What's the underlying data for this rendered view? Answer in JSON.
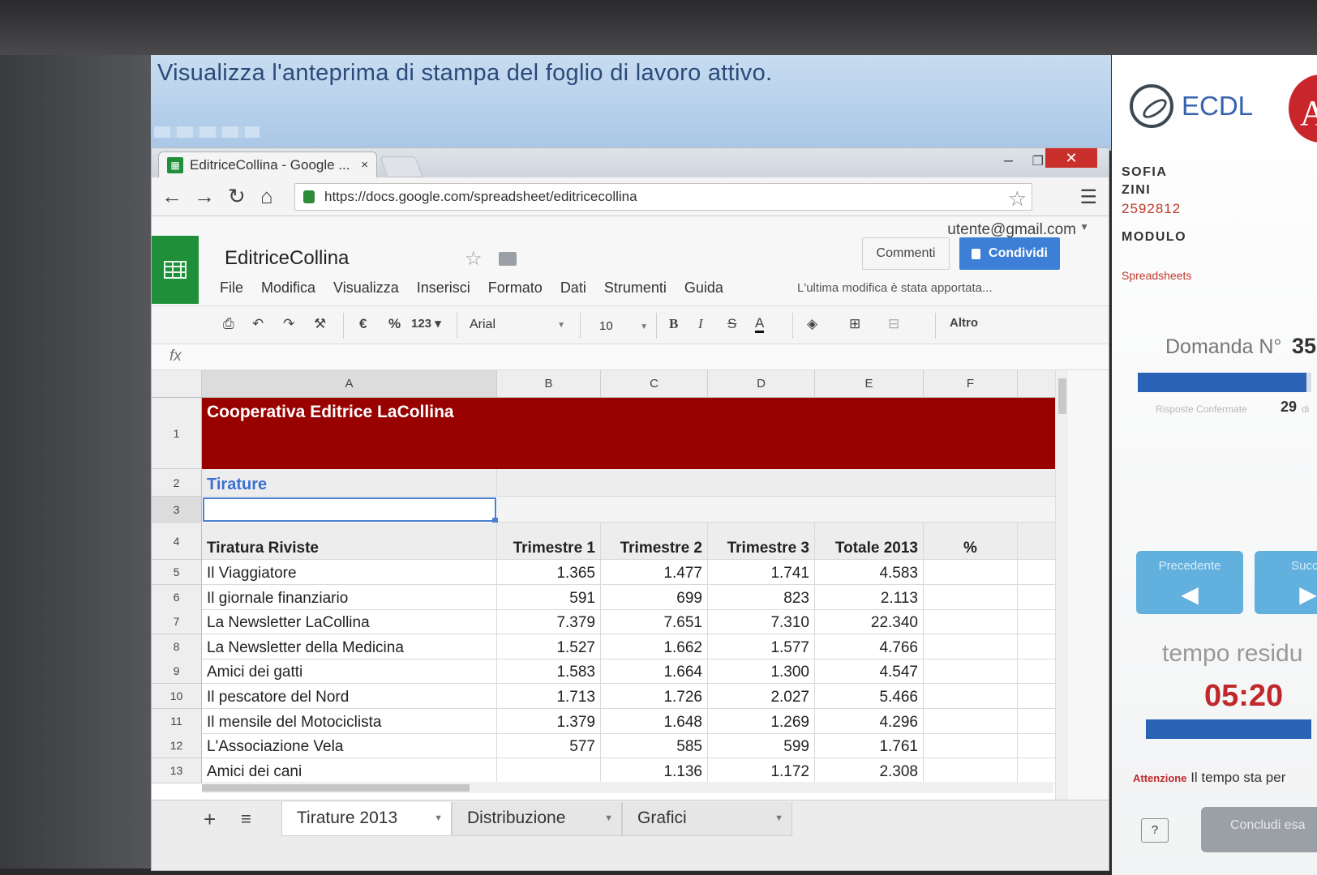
{
  "question": "Visualizza l'anteprima di stampa del foglio di lavoro attivo.",
  "browser": {
    "tab_title": "EditriceCollina - Google ...",
    "tab_close": "×",
    "url": "https://docs.google.com/spreadsheet/editricecollina",
    "window_min": "–",
    "window_max": "❐",
    "window_close": "✕"
  },
  "docs": {
    "user_email": "utente@gmail.com",
    "title": "EditriceCollina",
    "comments_label": "Commenti",
    "share_label": "Condividi",
    "menu": [
      "File",
      "Modifica",
      "Visualizza",
      "Inserisci",
      "Formato",
      "Dati",
      "Strumenti",
      "Guida"
    ],
    "last_edit": "L'ultima modifica è stata apportata...",
    "toolbar": {
      "currency": "€",
      "percent": "%",
      "number_format": "123 ▾",
      "font": "Arial",
      "font_size": "10",
      "bold": "B",
      "italic": "I",
      "strike": "S",
      "text_color": "A",
      "more": "Altro"
    },
    "fx": "fx"
  },
  "sheet": {
    "columns": [
      "A",
      "B",
      "C",
      "D",
      "E",
      "F"
    ],
    "title": "Cooperativa Editrice LaCollina",
    "subtitle": "Tirature",
    "headers": [
      "Tiratura Riviste",
      "Trimestre 1",
      "Trimestre 2",
      "Trimestre 3",
      "Totale 2013",
      "%"
    ],
    "rows": [
      [
        "Il Viaggiatore",
        "1.365",
        "1.477",
        "1.741",
        "4.583"
      ],
      [
        "Il giornale finanziario",
        "591",
        "699",
        "823",
        "2.113"
      ],
      [
        "La Newsletter LaCollina",
        "7.379",
        "7.651",
        "7.310",
        "22.340"
      ],
      [
        "La Newsletter della Medicina",
        "1.527",
        "1.662",
        "1.577",
        "4.766"
      ],
      [
        "Amici dei gatti",
        "1.583",
        "1.664",
        "1.300",
        "4.547"
      ],
      [
        "Il pescatore del Nord",
        "1.713",
        "1.726",
        "2.027",
        "5.466"
      ],
      [
        "Il mensile del Motociclista",
        "1.379",
        "1.648",
        "1.269",
        "4.296"
      ],
      [
        "L'Associazione Vela",
        "577",
        "585",
        "599",
        "1.761"
      ],
      [
        "Amici dei cani",
        "",
        "1.136",
        "1.172",
        "2.308"
      ]
    ],
    "tabs": [
      "Tirature 2013",
      "Distribuzione",
      "Grafici"
    ],
    "add_sheet": "+",
    "all_sheets": "≡"
  },
  "panel": {
    "logo_text": "ECDL",
    "aica_letter": "A",
    "first_name": "SOFIA",
    "last_name": "ZINI",
    "candidate_id": "2592812",
    "module_label": "MODULO",
    "module_name": "Spreadsheets",
    "question_label": "Domanda N°",
    "question_number": "35",
    "question_progress": 0.97,
    "answered_label": "Risposte Confermate",
    "answered_count": "29",
    "answered_of": "di",
    "prev_label": "Precedente",
    "next_label": "Succe",
    "time_label": "tempo residu",
    "time_value": "05:20",
    "warning_label": "Attenzione",
    "warning_text": "Il tempo sta per",
    "help_label": "?",
    "end_label": "Concludi esa"
  },
  "colors": {
    "title_band": "#990000",
    "subtitle": "#3b6fd1",
    "share": "#3d7fd6",
    "progress": "#2a62b5",
    "timer": "#c0282b",
    "nav_button": "#62b0de"
  }
}
